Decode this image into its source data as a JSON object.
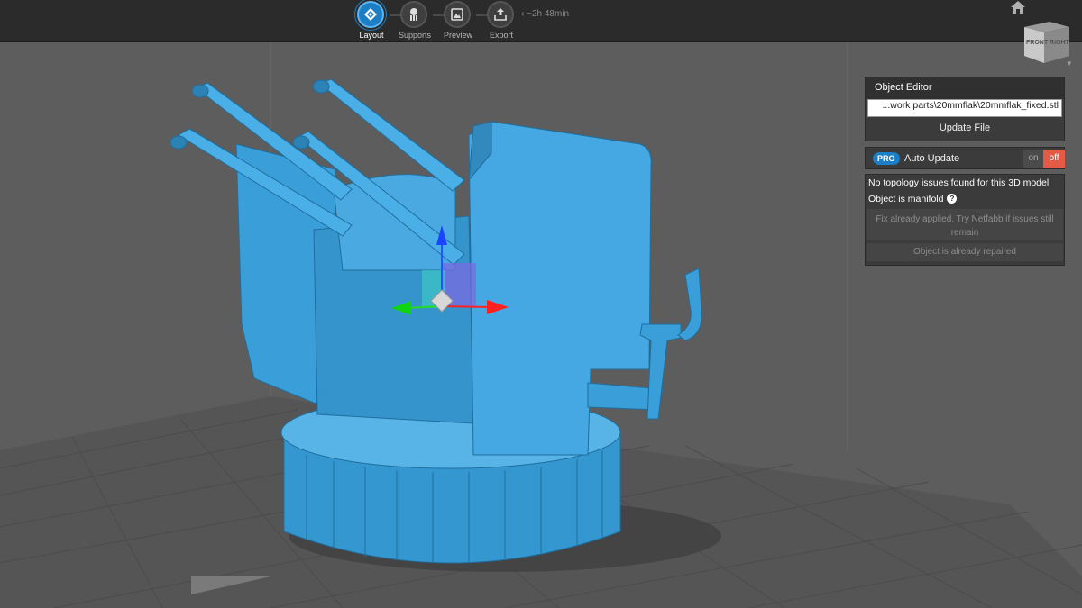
{
  "steps": [
    {
      "label": "Layout",
      "icon": "layout-icon",
      "active": true
    },
    {
      "label": "Supports",
      "icon": "supports-icon",
      "active": false
    },
    {
      "label": "Preview",
      "icon": "preview-icon",
      "active": false
    },
    {
      "label": "Export",
      "icon": "export-icon",
      "active": false
    }
  ],
  "eta": "~2h 48min",
  "view_cube": {
    "label": "FRONT RIGHT"
  },
  "object_editor": {
    "title": "Object Editor",
    "file_path": "...work parts\\20mmflak\\20mmflak_fixed.stl",
    "update_file_label": "Update File"
  },
  "auto_update": {
    "pro_badge": "PRO",
    "label": "Auto Update",
    "on_label": "on",
    "off_label": "off",
    "state": "off"
  },
  "topology": {
    "line1": "No topology issues found for this 3D model",
    "line2": "Object is manifold",
    "fix_label": "Fix already applied. Try Netfabb if issues still remain",
    "repaired_label": "Object is already repaired"
  },
  "colors": {
    "accent": "#1c7ec4",
    "toggle_off": "#e35a45",
    "model": "#3a9fd8",
    "viewport_bg": "#5d5d5d",
    "bed": "#555555"
  }
}
